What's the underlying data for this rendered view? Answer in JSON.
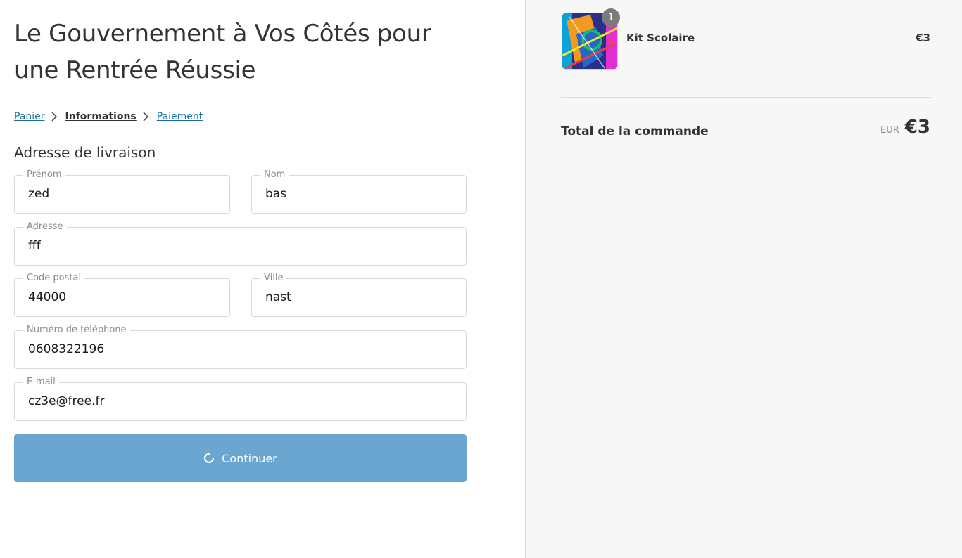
{
  "shop": {
    "title": "Le Gouvernement à Vos Côtés pour une Rentrée Réussie"
  },
  "breadcrumb": {
    "cart": "Panier",
    "information": "Informations",
    "payment": "Paiement"
  },
  "shipping": {
    "section_title": "Adresse de livraison",
    "first_name": {
      "label": "Prénom",
      "value": "zed"
    },
    "last_name": {
      "label": "Nom",
      "value": "bas"
    },
    "address": {
      "label": "Adresse",
      "value": "fff"
    },
    "postal_code": {
      "label": "Code postal",
      "value": "44000"
    },
    "city": {
      "label": "Ville",
      "value": "nast"
    },
    "phone": {
      "label": "Numéro de téléphone",
      "value": "0608322196"
    },
    "email": {
      "label": "E-mail",
      "value": "cz3e@free.fr"
    }
  },
  "continue_button": {
    "label": "Continuer",
    "state": "loading",
    "icon": "spinner-icon"
  },
  "order_summary": {
    "items": [
      {
        "name": "Kit Scolaire",
        "price": "€3",
        "quantity": "1"
      }
    ],
    "total_label": "Total de la commande",
    "currency_code": "EUR",
    "total_value": "€3"
  },
  "colors": {
    "link": "#1f6fa3",
    "button": "#6aa6cf",
    "sidebar_bg": "#f7f7f7",
    "badge": "#7b7b7b"
  }
}
